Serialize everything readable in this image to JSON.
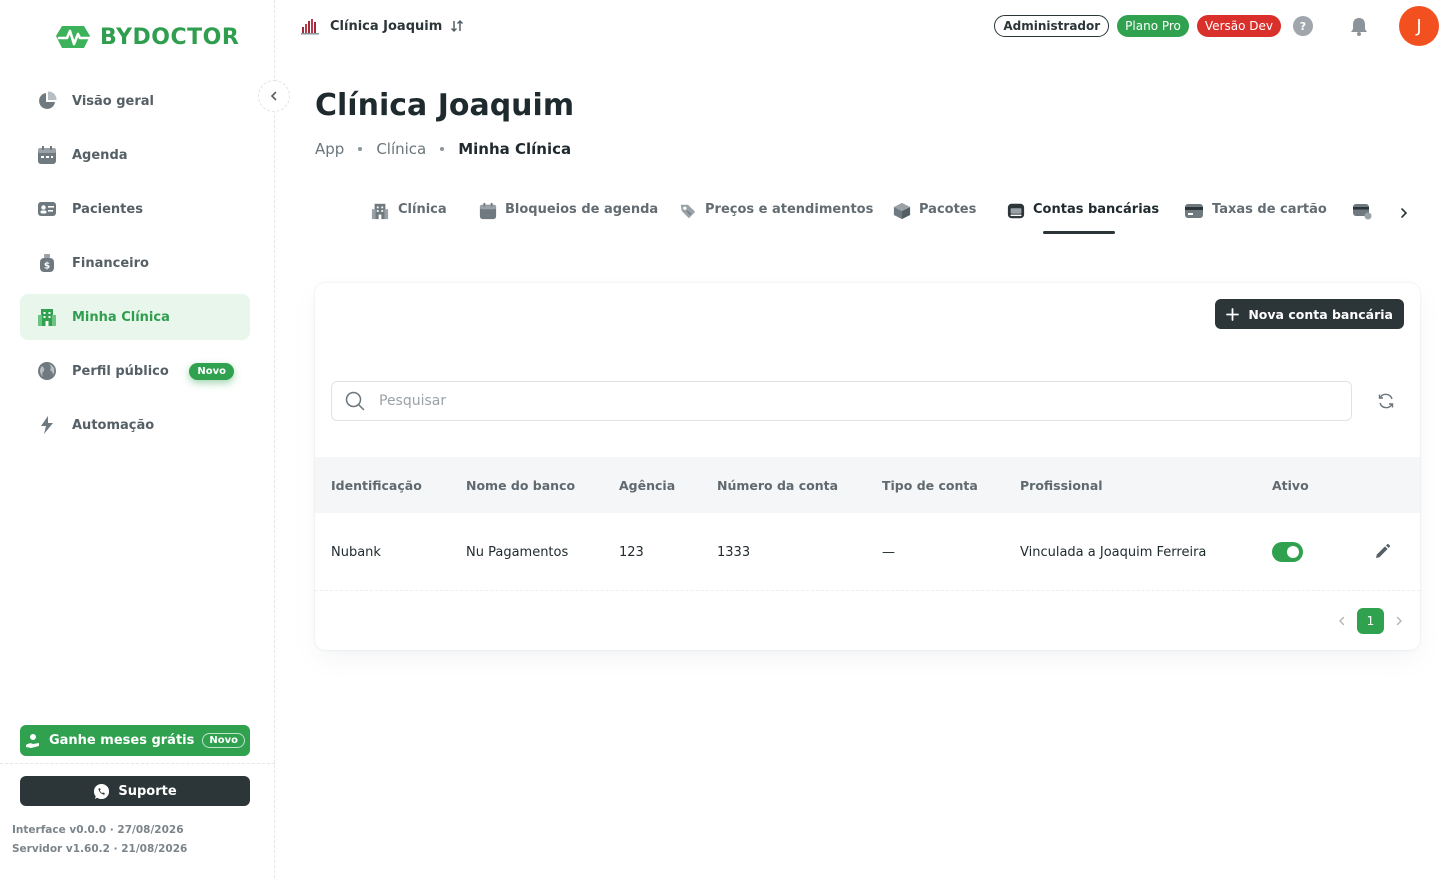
{
  "brand": {
    "name": "BYDOCTOR",
    "color": "#2f9e4e"
  },
  "sidebar": {
    "items": [
      {
        "label": "Visão geral",
        "icon": "pie-chart-icon"
      },
      {
        "label": "Agenda",
        "icon": "calendar-icon"
      },
      {
        "label": "Pacientes",
        "icon": "id-card-icon"
      },
      {
        "label": "Financeiro",
        "icon": "money-bag-icon"
      },
      {
        "label": "Minha Clínica",
        "icon": "building-icon",
        "active": true
      },
      {
        "label": "Perfil público",
        "icon": "globe-icon",
        "badge": "Novo"
      },
      {
        "label": "Automação",
        "icon": "lightning-icon"
      }
    ],
    "promo": {
      "label": "Ganhe meses grátis",
      "badge": "Novo"
    },
    "support_label": "Suporte",
    "interface_version": "Interface v0.0.0 · 27/08/2026",
    "server_version": "Servidor v1.60.2 · 21/08/2026"
  },
  "header": {
    "clinic_name": "Clínica Joaquim",
    "role_chip": "Administrador",
    "plan_chip": "Plano Pro",
    "env_chip": "Versão Dev",
    "help_label": "?",
    "avatar_initial": "J"
  },
  "page": {
    "title": "Clínica Joaquim",
    "breadcrumb": [
      "App",
      "Clínica",
      "Minha Clínica"
    ]
  },
  "tabs": [
    {
      "label": "Clínica",
      "icon": "building-icon"
    },
    {
      "label": "Bloqueios de agenda",
      "icon": "calendar-icon"
    },
    {
      "label": "Preços e atendimentos",
      "icon": "price-tag-icon"
    },
    {
      "label": "Pacotes",
      "icon": "package-icon"
    },
    {
      "label": "Contas bancárias",
      "icon": "bank-icon",
      "active": true
    },
    {
      "label": "Taxas de cartão",
      "icon": "credit-card-icon"
    }
  ],
  "card": {
    "new_button": "Nova conta bancária",
    "search_placeholder": "Pesquisar",
    "columns": [
      "Identificação",
      "Nome do banco",
      "Agência",
      "Número da conta",
      "Tipo de conta",
      "Profissional",
      "Ativo"
    ],
    "rows": [
      {
        "identificacao": "Nubank",
        "banco": "Nu Pagamentos",
        "agencia": "123",
        "conta": "1333",
        "tipo": "—",
        "profissional": "Vinculada a Joaquim Ferreira",
        "ativo": true
      }
    ],
    "current_page": "1"
  },
  "colors": {
    "primary": "#2fa14f",
    "dark": "#2c3538",
    "danger": "#d9302c",
    "avatar": "#f3501f"
  }
}
